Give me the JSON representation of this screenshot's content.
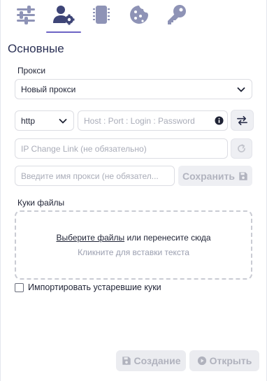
{
  "tabs": [
    {
      "icon": "sliders-icon",
      "active": false
    },
    {
      "icon": "user-gear-icon",
      "active": true
    },
    {
      "icon": "chip-icon",
      "active": false
    },
    {
      "icon": "cookie-icon",
      "active": false
    },
    {
      "icon": "key-icon",
      "active": false
    }
  ],
  "section_title": "Основные",
  "proxy": {
    "label": "Прокси",
    "selected": "Новый прокси",
    "protocol": "http",
    "host_placeholder": "Host : Port : Login : Password",
    "change_link_placeholder": "IP Change Link (не обязательно)",
    "name_placeholder": "Введите имя прокси (не обязател...",
    "save_label": "Сохранить"
  },
  "cookies": {
    "label": "Куки файлы",
    "select_files_link": "Выберите файлы",
    "drop_text": "или перенесите сюда",
    "paste_hint": "Кликните для вставки текста",
    "import_old_label": "Импортировать устаревшие куки"
  },
  "footer": {
    "create_label": "Создание",
    "open_label": "Открыть"
  },
  "colors": {
    "accent": "#6c63c4",
    "icon_muted": "#8e93b6",
    "disabled_text": "#b0b2bd"
  }
}
